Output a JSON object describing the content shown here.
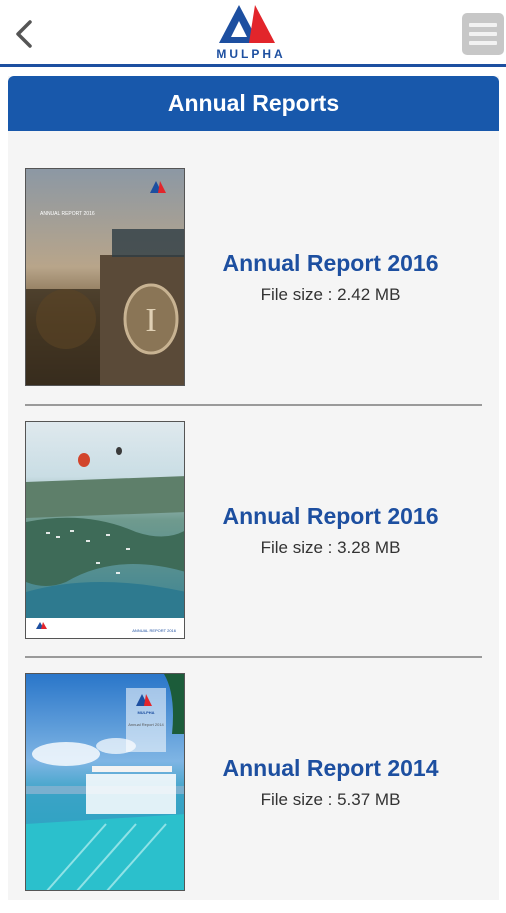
{
  "header": {
    "brand": "MULPHA",
    "back_icon": "chevron-left-icon",
    "menu_icon": "hamburger-menu-icon",
    "accent_color": "#1d4fa0",
    "logo_colors": [
      "#1d4fa0",
      "#e2252b"
    ]
  },
  "page": {
    "title": "Annual Reports",
    "title_bar_color": "#1858ab"
  },
  "reports": [
    {
      "title": "Annual Report 2016",
      "file_size": "File size : 2.42 MB",
      "cover_caption": "ANNUAL REPORT 2016"
    },
    {
      "title": "Annual Report 2016",
      "file_size": "File size : 3.28 MB",
      "cover_caption": "ANNUAL REPORT 2016"
    },
    {
      "title": "Annual Report 2014",
      "file_size": "File size : 5.37 MB",
      "cover_caption": "Annual Report 2014"
    }
  ]
}
